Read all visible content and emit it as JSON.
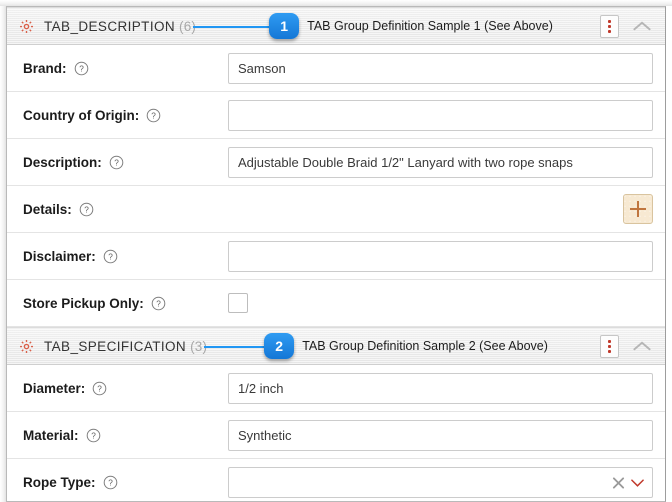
{
  "sections": [
    {
      "gear_icon": "gear-icon",
      "title": "TAB_DESCRIPTION",
      "count": "(6)",
      "badge": "1",
      "callout_text": "TAB Group Definition Sample 1 (See Above)",
      "menu_icon": "kebab-menu-icon",
      "collapse_icon": "chevron-up-icon",
      "rows": [
        {
          "label": "Brand:",
          "help_icon": "help-icon",
          "control": "text",
          "value": "Samson",
          "placeholder": ""
        },
        {
          "label": "Country of Origin:",
          "help_icon": "help-icon",
          "control": "text",
          "value": "",
          "placeholder": ""
        },
        {
          "label": "Description:",
          "help_icon": "help-icon",
          "control": "text",
          "value": "Adjustable Double Braid 1/2\" Lanyard with two rope snaps",
          "placeholder": ""
        },
        {
          "label": "Details:",
          "help_icon": "help-icon",
          "control": "add-button",
          "add_icon": "plus-icon",
          "value": "",
          "placeholder": ""
        },
        {
          "label": "Disclaimer:",
          "help_icon": "help-icon",
          "control": "text",
          "value": "",
          "placeholder": ""
        },
        {
          "label": "Store Pickup Only:",
          "help_icon": "help-icon",
          "control": "checkbox",
          "checked": false,
          "value": "",
          "placeholder": ""
        }
      ]
    },
    {
      "gear_icon": "gear-icon",
      "title": "TAB_SPECIFICATION",
      "count": "(3)",
      "badge": "2",
      "callout_text": "TAB Group Definition Sample 2 (See Above)",
      "menu_icon": "kebab-menu-icon",
      "collapse_icon": "chevron-up-icon",
      "rows": [
        {
          "label": "Diameter:",
          "help_icon": "help-icon",
          "control": "text",
          "value": "1/2 inch",
          "placeholder": ""
        },
        {
          "label": "Material:",
          "help_icon": "help-icon",
          "control": "text",
          "value": "Synthetic",
          "placeholder": ""
        },
        {
          "label": "Rope Type:",
          "help_icon": "help-icon",
          "control": "dropdown",
          "value": "",
          "placeholder": "",
          "clear_icon": "clear-x-icon",
          "chevron_icon": "chevron-down-icon"
        }
      ]
    }
  ],
  "colors": {
    "badge_blue": "#1477d6",
    "callout_line": "#2196f3",
    "gear_orange": "#d9604a",
    "kebab_dot_red": "#c0392b",
    "plus_orange": "#c0763f",
    "add_button_bg": "#f7e9d2",
    "dropdown_chevron_red": "#c0392b",
    "header_bg": "#ededed",
    "border_gray": "#cccccc"
  }
}
